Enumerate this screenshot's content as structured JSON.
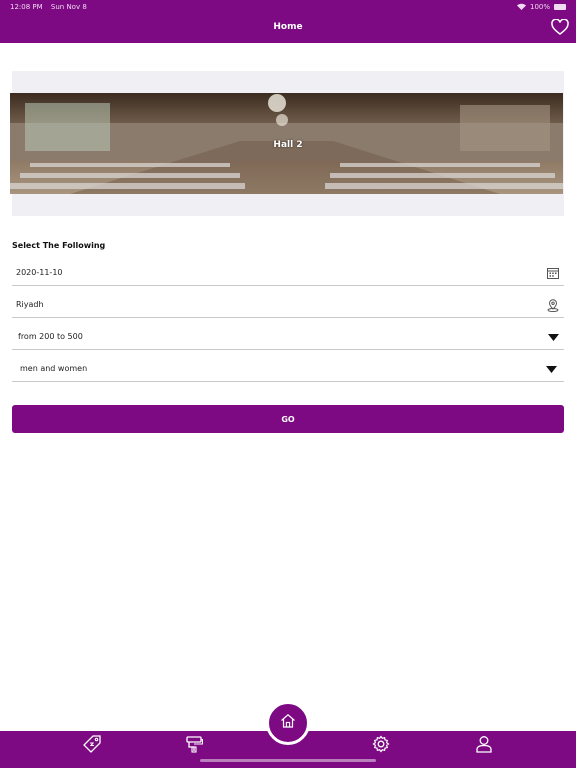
{
  "status_bar": {
    "time": "12:08 PM",
    "date": "Sun Nov 8",
    "battery": "100%"
  },
  "header": {
    "title": "Home"
  },
  "hall": {
    "name": "Hall 2"
  },
  "form": {
    "section_title": "Select The Following",
    "date_value": "2020-11-10",
    "city_value": "Riyadh",
    "capacity_value": "from 200 to 500",
    "type_value": "men and women",
    "go_label": "GO"
  },
  "colors": {
    "brand": "#7d0a83",
    "card_bg": "#f0f0f4",
    "divider": "#c9c9c9"
  },
  "tabs": [
    "offers-icon",
    "services-icon",
    "home-icon",
    "settings-icon",
    "profile-icon"
  ]
}
